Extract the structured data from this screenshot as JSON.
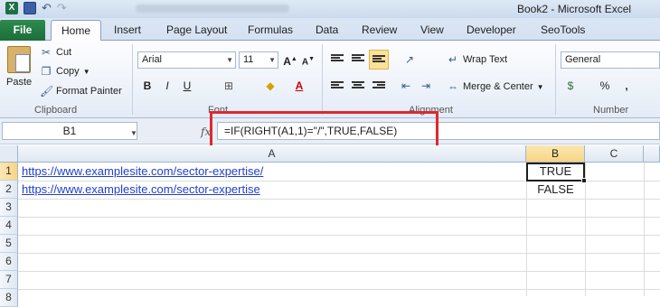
{
  "window": {
    "title": "Book2  -  Microsoft Excel"
  },
  "tabs": [
    "File",
    "Home",
    "Insert",
    "Page Layout",
    "Formulas",
    "Data",
    "Review",
    "View",
    "Developer",
    "SeoTools"
  ],
  "ribbon": {
    "clipboard": {
      "paste": "Paste",
      "cut": "Cut",
      "copy": "Copy",
      "format_painter": "Format Painter",
      "label": "Clipboard"
    },
    "font": {
      "name": "Arial",
      "size": "11",
      "bold": "B",
      "italic": "I",
      "underline": "U",
      "label": "Font"
    },
    "alignment": {
      "wrap_text": "Wrap Text",
      "merge_center": "Merge & Center",
      "label": "Alignment"
    },
    "number": {
      "format": "General",
      "percent": "%",
      "comma": ",",
      "label": "Number"
    }
  },
  "formula_bar": {
    "name_box": "B1",
    "fx": "fx",
    "formula": "=IF(RIGHT(A1,1)=\"/\",TRUE,FALSE)"
  },
  "grid": {
    "columns": [
      "A",
      "B",
      "C"
    ],
    "rows": [
      "1",
      "2",
      "3",
      "4",
      "5",
      "6",
      "7",
      "8"
    ],
    "cells": {
      "A1": "https://www.examplesite.com/sector-expertise/",
      "A2": "https://www.examplesite.com/sector-expertise",
      "B1": "TRUE",
      "B2": "FALSE"
    }
  },
  "colors": {
    "file_tab": "#1e7145",
    "highlight": "#e0282e",
    "link": "#1f3fd0"
  }
}
